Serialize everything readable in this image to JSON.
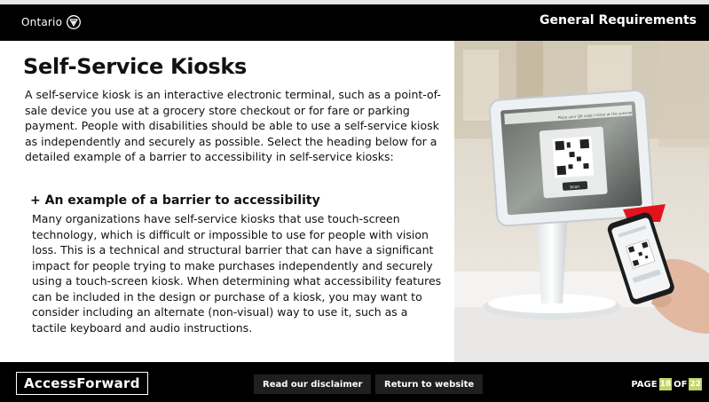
{
  "header": {
    "logo_text": "Ontario",
    "section_title": "General Requirements"
  },
  "main": {
    "title": "Self-Service Kiosks",
    "intro": "A self-service kiosk is an interactive electronic terminal, such as a point-of-sale device you use at a grocery store checkout or for fare or parking payment. People with disabilities should be able to use a self-service kiosk as independently and securely as possible. Select the heading below for a detailed example of a barrier to accessibility in self-service kiosks:",
    "accordion": {
      "heading": "+ An example of a barrier to accessibility",
      "body": "Many organizations have self-service kiosks that use touch-screen technology, which is difficult or impossible to use for people with vision loss. This is a technical and structural barrier that can have a significant impact for people trying to make purchases independently and securely using a touch-screen kiosk. When determining what accessibility features can be included in the design or purchase of a kiosk, you may want to consider including an alternate (non-visual) way to use it, such as a tactile keyboard and audio instructions."
    }
  },
  "photo": {
    "screen_text": "Place your QR code / ticket at the scanner",
    "screen_button": "Scan"
  },
  "footer": {
    "brand": "AccessForward",
    "disclaimer_label": "Read our disclaimer",
    "return_label": "Return to website",
    "page_label": "PAGE",
    "current_page": "18",
    "of_label": "OF",
    "total_pages": "22"
  },
  "colors": {
    "header_bg": "#000000",
    "footer_bg": "#000000",
    "page_badge": "#c7d36a",
    "kiosk_red_tab": "#e1141e"
  }
}
